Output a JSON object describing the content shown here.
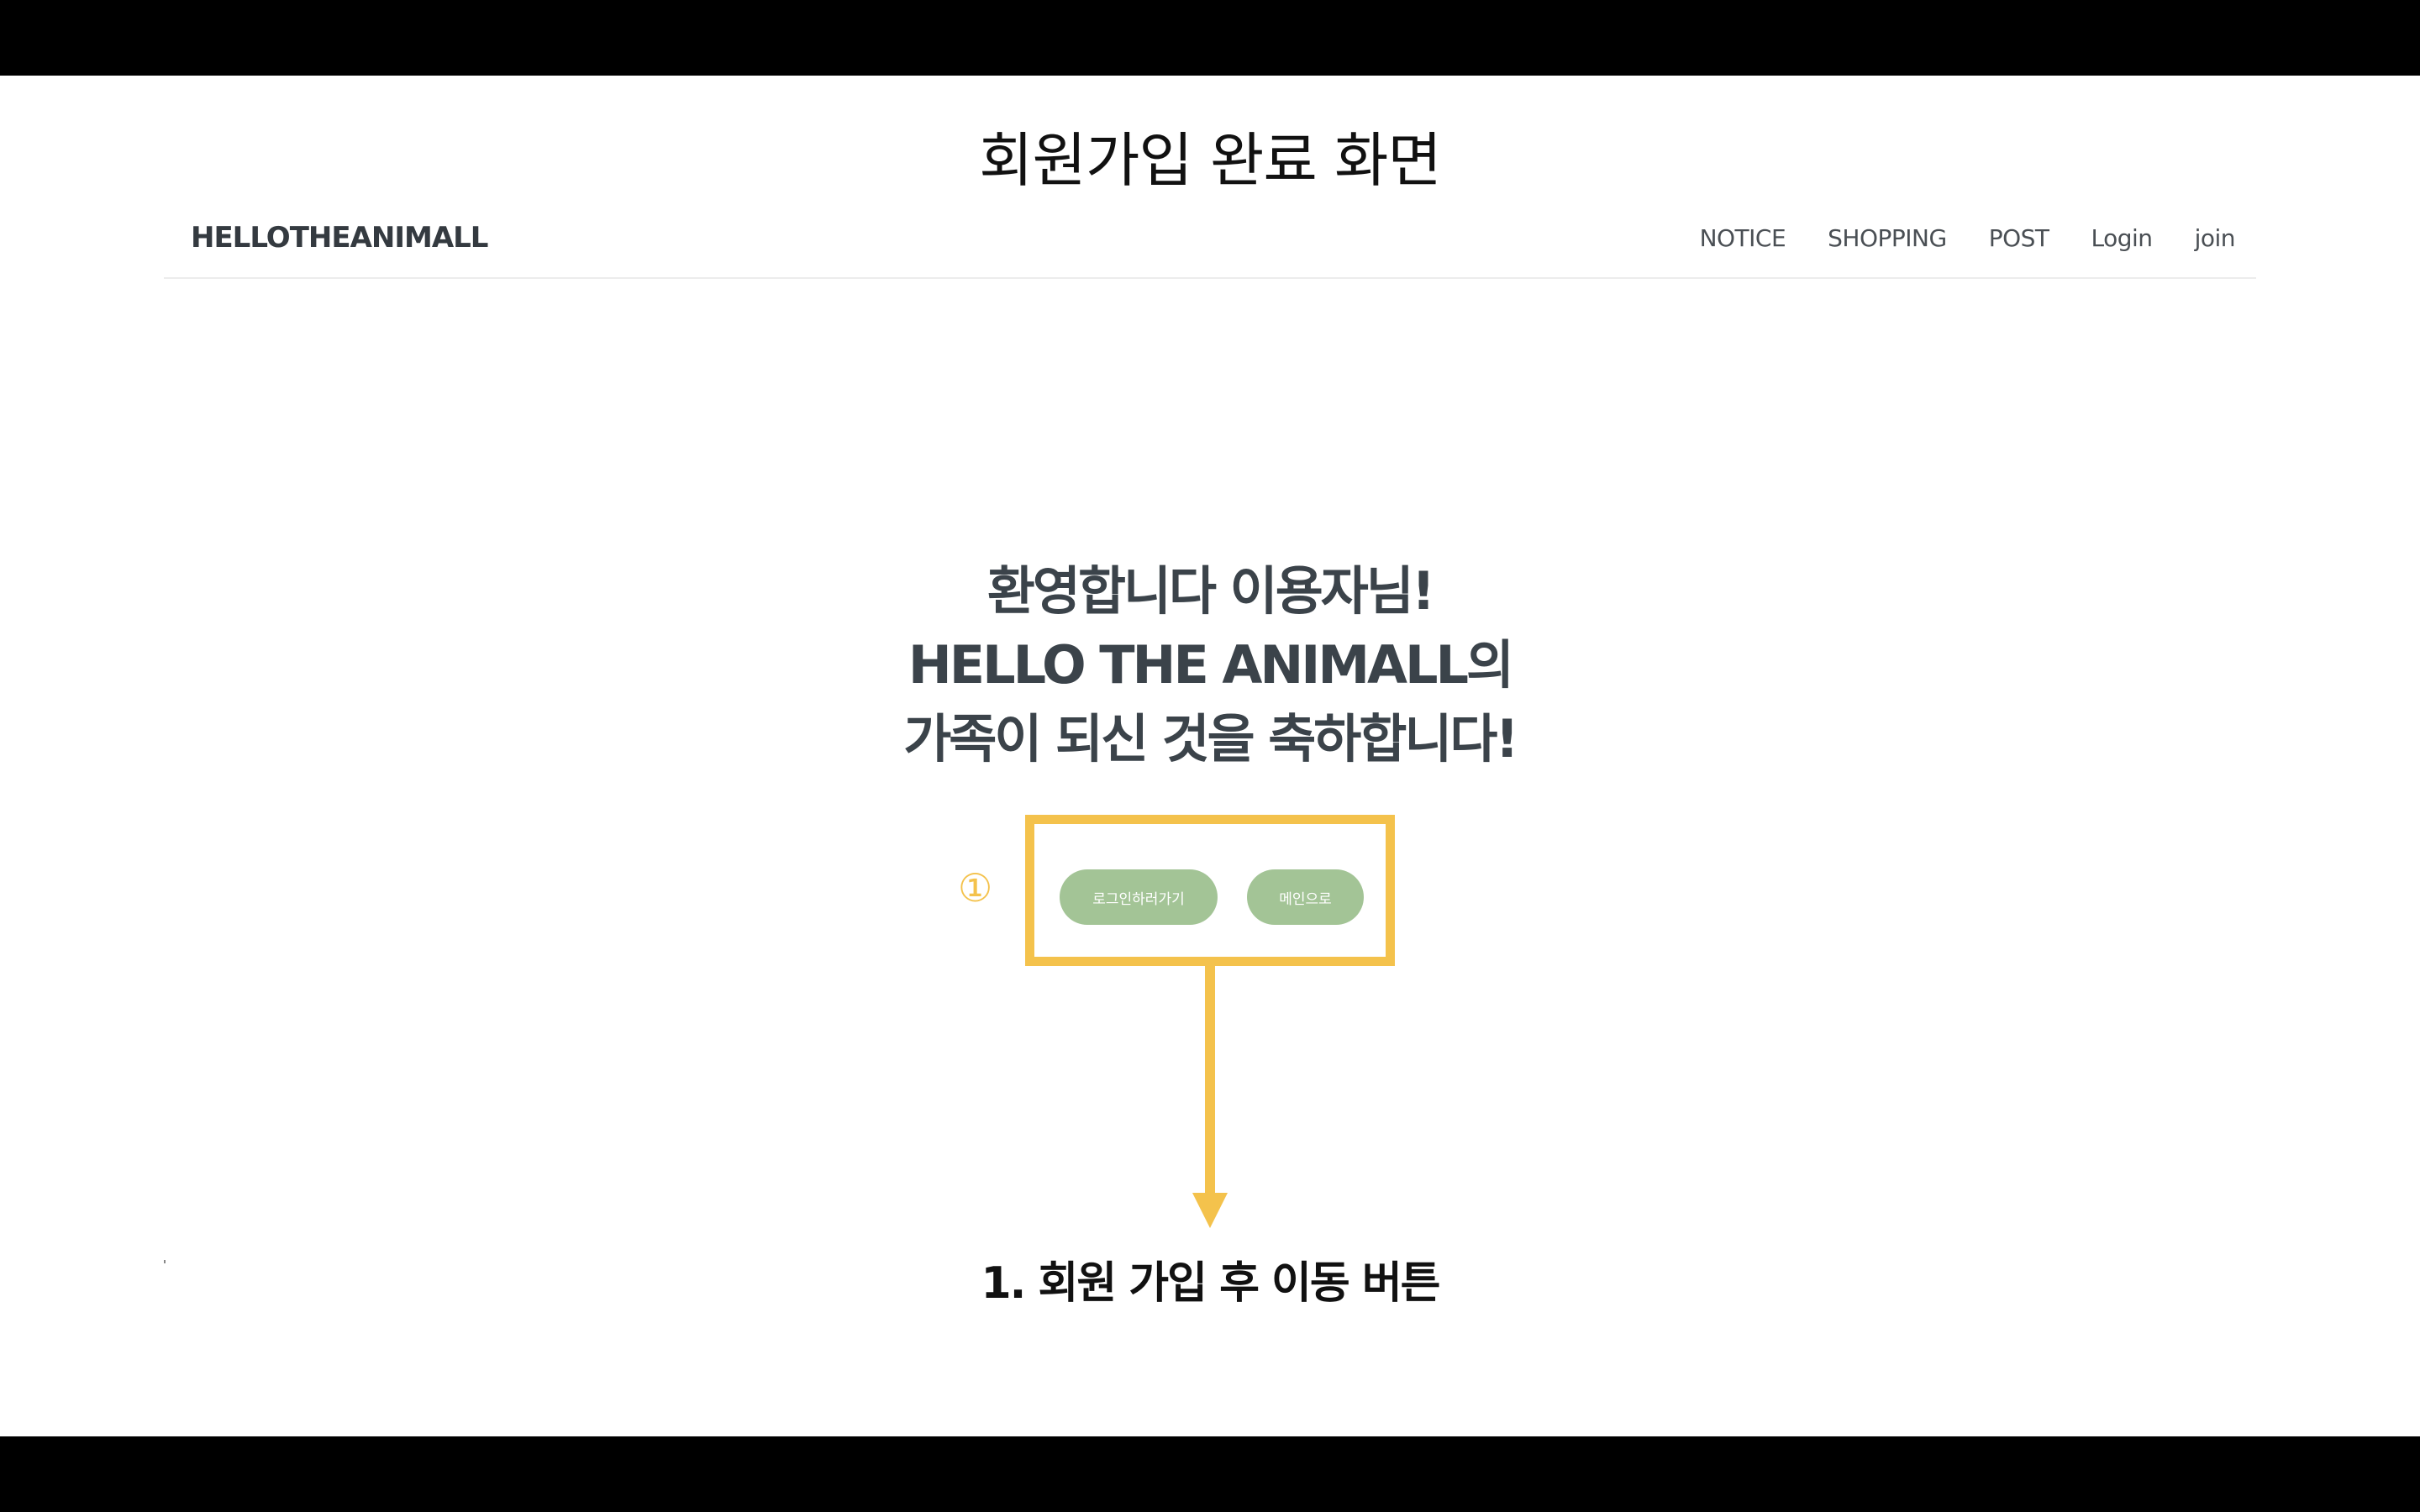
{
  "slide_title": "회원가입 완료 화면",
  "navbar": {
    "logo": "HELLOTHEANIMALL",
    "items": [
      {
        "label": "NOTICE"
      },
      {
        "label": "SHOPPING"
      },
      {
        "label": "POST"
      },
      {
        "label": "Login"
      },
      {
        "label": "join"
      }
    ]
  },
  "welcome": {
    "line1": "환영합니다 이용자님!",
    "line2": "HELLO THE ANIMALL의",
    "line3": "가족이 되신 것을 축하합니다!"
  },
  "buttons": {
    "login_label": "로그인하러가기",
    "main_label": "메인으로"
  },
  "annotation": {
    "marker": "①",
    "caption": "1. 회원 가입 후  이동 버튼",
    "color": "#f4c24c"
  },
  "colors": {
    "button_bg": "#a3c496",
    "heading_text": "#3b434a"
  }
}
